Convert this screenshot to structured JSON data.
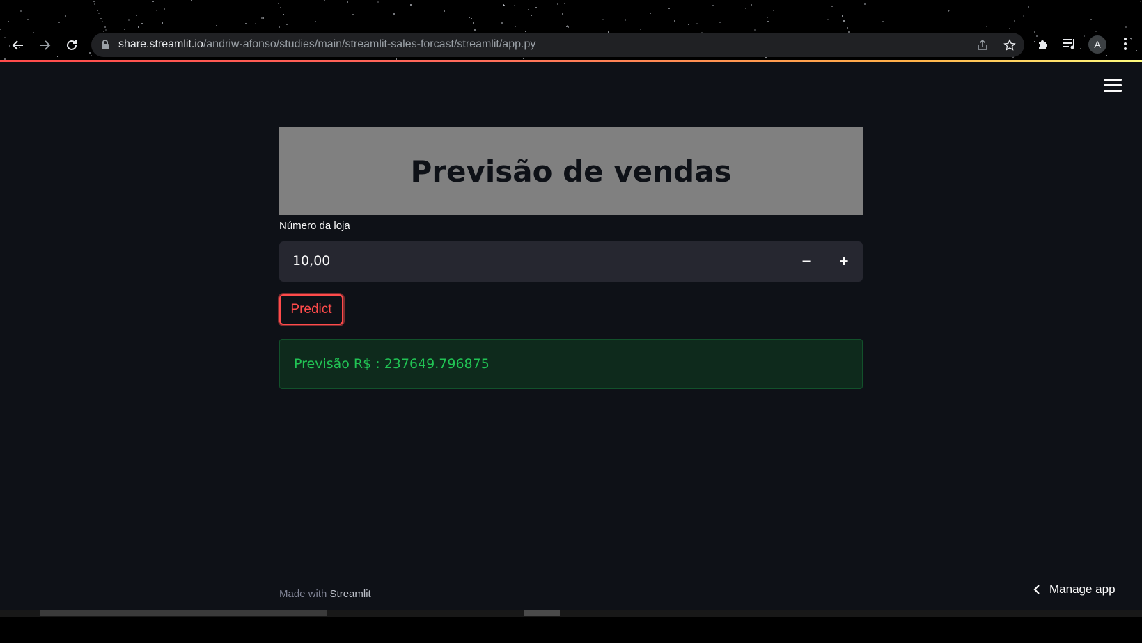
{
  "browser": {
    "url_host": "share.streamlit.io",
    "url_path": "/andriw-afonso/studies/main/streamlit-sales-forcast/streamlit/app.py",
    "profile_initial": "A",
    "icons": [
      "back-icon",
      "forward-icon",
      "reload-icon",
      "lock-icon",
      "share-icon",
      "star-icon",
      "extensions-icon",
      "media-icon",
      "menu-icon"
    ]
  },
  "app": {
    "title": "Previsão de vendas",
    "store_field": {
      "label": "Número da loja",
      "value": "10,00",
      "decrement": "−",
      "increment": "+"
    },
    "predict_label": "Predict",
    "result_text": "Previsão R$ : 237649.796875",
    "footer": {
      "prefix": "Made with ",
      "brand": "Streamlit"
    },
    "manage_app": "Manage app"
  },
  "colors": {
    "app_bg": "#0e1117",
    "title_bg": "#808080",
    "primary": "#ff4b4b",
    "success_text": "#21c354",
    "success_bg": "#0e2a1c"
  }
}
